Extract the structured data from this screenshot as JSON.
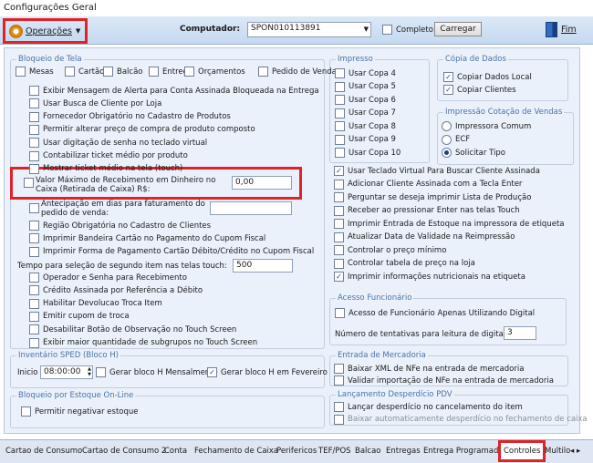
{
  "window": {
    "title": "Configurações Geral"
  },
  "toolbar": {
    "operacoes_label": "Operações",
    "computador_label": "Computador:",
    "computador_value": "SPON010113891",
    "completo_label": "Completo",
    "carregar_label": "Carregar",
    "fim_label": "Fim"
  },
  "bloqueio_tela": {
    "title": "Bloqueio de Tela",
    "top_row": [
      "Mesas",
      "Cartão",
      "Balcão",
      "Entrega",
      "Orçamentos",
      "Pedido de Venda"
    ],
    "items": [
      "Exibir Mensagem de Alerta para Conta Assinada Bloqueada na Entrega",
      "Usar Busca de Cliente por Loja",
      "Fornecedor Obrigatório no Cadastro de Produtos",
      "Permitir alterar preço de compra de produto composto",
      "Usar digitação de senha no teclado virtual",
      "Contabilizar ticket médio por produto",
      "Mostrar ticket médio na tela (touch)"
    ],
    "valor_maximo_label": "Valor Máximo de Recebimento em Dinheiro no Caixa (Retirada de Caixa) R$:",
    "valor_maximo_value": "0,00",
    "antecipacao_label": "Antecipação em dias para faturamento do pedido de venda:",
    "items2": [
      "Região Obrigatória no Cadastro de Clientes",
      "Imprimir Bandeira Cartão no Pagamento do Cupom Fiscal",
      "Imprimir Forma de Pagamento Cartão Débito/Crédito no Cupom Fiscal"
    ],
    "tempo_label": "Tempo para seleção de segundo item nas telas touch:",
    "tempo_value": "500",
    "items3": [
      "Operador e Senha para Recebimento",
      "Crédito Assinada por Referência a Débito",
      "Habilitar Devolucao Troca Item",
      "Emitir cupom de troca",
      "Desabilitar Botão de Observação no Touch Screen",
      "Exibir maior quantidade de subgrupos no Touch Screen"
    ]
  },
  "inventario": {
    "title": "Inventário SPED (Bloco H)",
    "inicio_label": "Inicio",
    "inicio_value": "08:00:00",
    "gerar_mensal": "Gerar bloco H Mensalmente",
    "gerar_fevereiro": "Gerar bloco H em Fevereiro"
  },
  "bloqueio_estoque": {
    "title": "Bloqueio por Estoque On-Line",
    "permitir": "Permitir negativar estoque"
  },
  "impresso": {
    "title": "Impresso",
    "copas": [
      "Usar Copa 4",
      "Usar Copa 5",
      "Usar Copa 6",
      "Usar Copa 7",
      "Usar Copa 8",
      "Usar Copa 9",
      "Usar Copa 10"
    ]
  },
  "copia_dados": {
    "title": "Cópia de Dados",
    "items": [
      "Copiar Dados Local",
      "Copiar Clientes"
    ]
  },
  "impressao_cotacao": {
    "title": "Impressão Cotação de Vendas",
    "options": [
      "Impressora Comum",
      "ECF",
      "Solicitar Tipo"
    ]
  },
  "right_items": [
    "Usar Teclado Virtual Para Buscar Cliente Assinada",
    "Adicionar Cliente Assinada com a Tecla Enter",
    "Perguntar se deseja imprimir Lista de Produção",
    "Receber ao pressionar Enter nas telas Touch",
    "Imprimir Entrada de Estoque na impressora de etiqueta",
    "Atualizar Data de Validade na Reimpressão",
    "Controlar o preço mínimo",
    "Controlar tabela de preço na loja",
    "Imprimir informações nutricionais na etiqueta"
  ],
  "acesso_funcionario": {
    "title": "Acesso Funcionário",
    "item": "Acesso de Funcionário Apenas Utilizando Digital",
    "tentativas_label": "Número de tentativas para leitura de digital:",
    "tentativas_value": "3"
  },
  "entrada_mercadoria": {
    "title": "Entrada de Mercadoria",
    "items": [
      "Baixar XML de NFe na entrada de mercadoria",
      "Validar importação de NFe na entrada de mercadoria"
    ]
  },
  "lancamento_desperdicio": {
    "title": "Lançamento Desperdício PDV",
    "items": [
      "Lançar desperdício no cancelamento do item",
      "Baixar automaticamente desperdício no fechamento de caixa"
    ]
  },
  "tabs": [
    "Cartao de Consumo",
    "Cartao de Consumo 2",
    "Conta",
    "Fechamento de Caixa",
    "Perifericos",
    "TEF/POS",
    "Balcao",
    "Entregas",
    "Entrega Programada",
    "Controles",
    "Multiloj"
  ],
  "colors": {
    "accent": "#e0222a",
    "group_title": "#4a73a6",
    "panel": "#eaf1fb"
  }
}
